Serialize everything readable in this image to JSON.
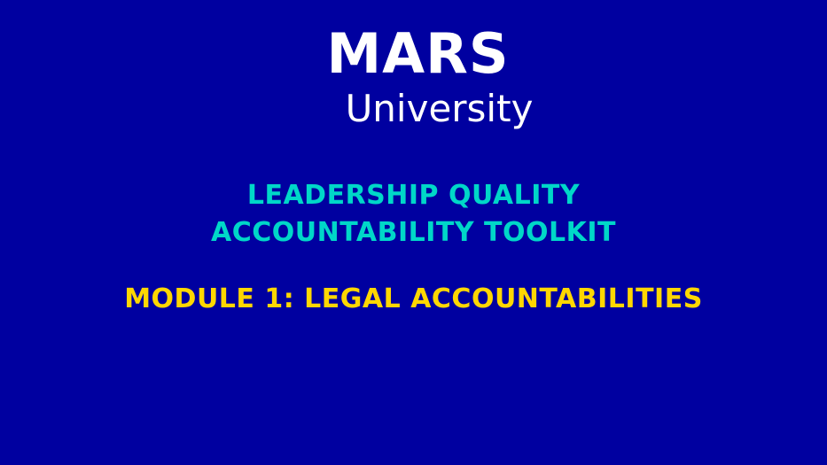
{
  "logo": {
    "brand": "MARS",
    "sub": "University"
  },
  "title": {
    "line1": "LEADERSHIP QUALITY",
    "line2": "ACCOUNTABILITY TOOLKIT"
  },
  "module": {
    "label": "MODULE 1: LEGAL ACCOUNTABILITIES"
  },
  "colors": {
    "background": "#0000a0",
    "logo": "#ffffff",
    "title": "#00d7c8",
    "module": "#ffd700"
  }
}
